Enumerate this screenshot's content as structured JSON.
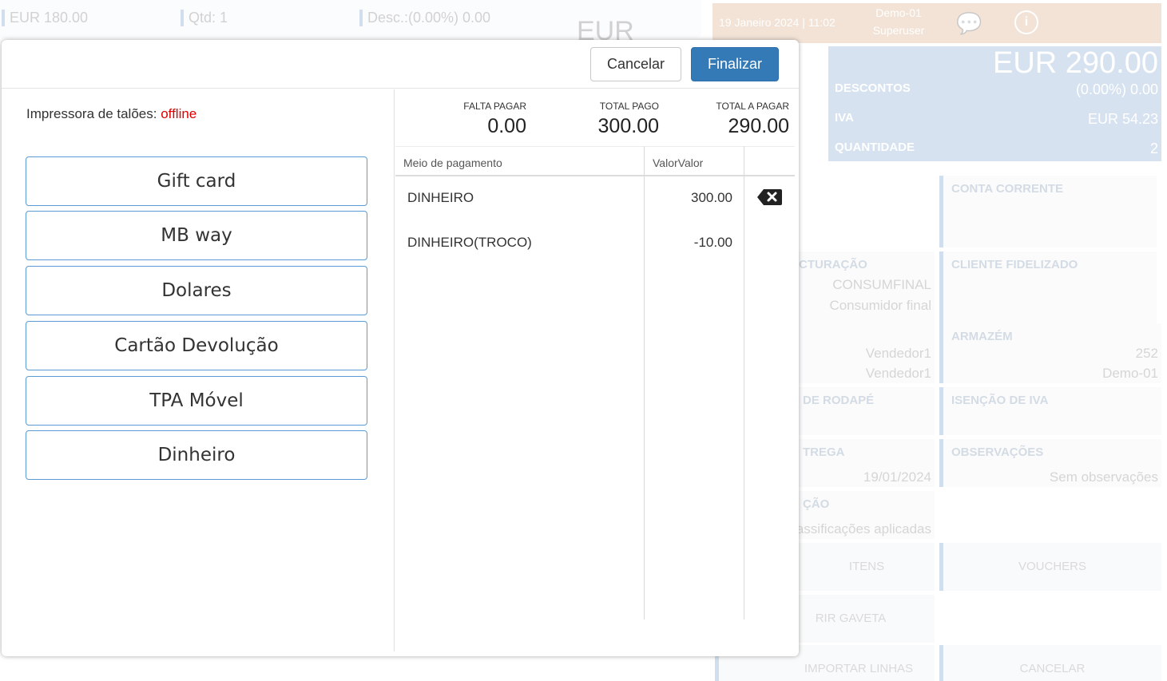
{
  "background": {
    "top_price": "EUR 180.00",
    "top_qty": "Qtd: 1",
    "top_desc": "Desc.:(0.00%) 0.00",
    "top_eur": "EUR",
    "header_date": "19 Janeiro 2024 | 11:02",
    "header_store": "Demo-01",
    "header_user": "Superuser",
    "summary_total": "EUR 290.00",
    "descontos_label": "DESCONTOS",
    "descontos_value": "(0.00%) 0.00",
    "iva_label": "IVA",
    "iva_value": "EUR 54.23",
    "quantidade_label": "QUANTIDADE",
    "quantidade_value": "2",
    "conta_corrente": "CONTA CORRENTE",
    "faturacao_label": "CTURAÇÃO",
    "faturacao_v1": "CONSUMFINAL",
    "faturacao_v2": "Consumidor final",
    "cliente_fidelizado": "CLIENTE FIDELIZADO",
    "vendedor_v1": "Vendedor1",
    "vendedor_v2": "Vendedor1",
    "armazem_label": "ARMAZÉM",
    "armazem_v1": "252",
    "armazem_v2": "Demo-01",
    "rodape_label": "DE RODAPÉ",
    "isencao_label": "ISENÇÃO DE IVA",
    "entrega_label": "TREGA",
    "entrega_value": "19/01/2024",
    "observacoes_label": "OBSERVAÇÕES",
    "observacoes_value": "Sem observações",
    "classificacao_label": "ÇÃO",
    "classificacao_value": "assificações aplicadas",
    "btn_itens": "ITENS",
    "btn_vouchers": "VOUCHERS",
    "btn_gaveta": "RIR GAVETA",
    "btn_importar": "IMPORTAR LINHAS",
    "btn_cancelar": "CANCELAR"
  },
  "modal": {
    "cancel_label": "Cancelar",
    "finish_label": "Finalizar",
    "printer_label": "Impressora de talões:",
    "printer_status": "offline",
    "payment_methods": [
      "Gift card",
      "MB way",
      "Dolares",
      "Cartão Devolução",
      "TPA Móvel",
      "Dinheiro"
    ],
    "totals": {
      "falta_label": "FALTA PAGAR",
      "falta_value": "0.00",
      "pago_label": "TOTAL PAGO",
      "pago_value": "300.00",
      "apagar_label": "TOTAL A PAGAR",
      "apagar_value": "290.00"
    },
    "grid_headers": {
      "method": "Meio de pagamento",
      "value": "ValorValor"
    },
    "payments": [
      {
        "method": "DINHEIRO",
        "amount": "300.00"
      },
      {
        "method": "DINHEIRO(TROCO)",
        "amount": "-10.00"
      }
    ]
  }
}
